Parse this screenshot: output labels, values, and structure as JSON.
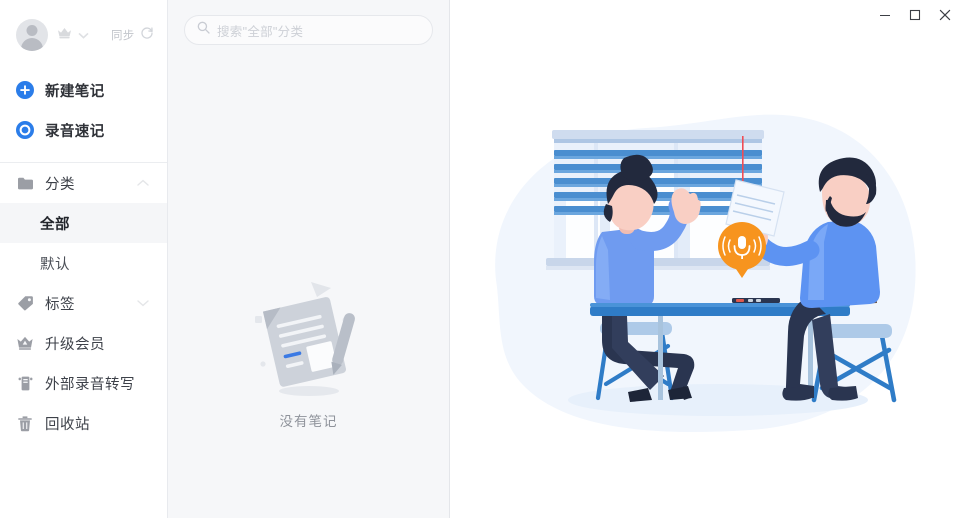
{
  "window": {
    "controls": [
      {
        "name": "minimize",
        "glyph": "minimize-icon",
        "label": "Minimize"
      },
      {
        "name": "maximize",
        "glyph": "maximize-icon",
        "label": "Maximize"
      },
      {
        "name": "close",
        "glyph": "close-icon",
        "label": "Close"
      }
    ]
  },
  "sidebar": {
    "account": {
      "avatar_icon": "user-avatar-icon",
      "vip_icon": "crown-icon",
      "dropdown_icon": "chevron-down-icon",
      "sync_label": "同步",
      "sync_icon": "refresh-icon"
    },
    "actions": [
      {
        "label": "新建笔记",
        "icon": "plus-circle-icon",
        "color": "#2b7de9"
      },
      {
        "label": "录音速记",
        "icon": "record-circle-icon",
        "color": "#2b7de9"
      }
    ],
    "groups": [
      {
        "label": "分类",
        "icon": "folder-icon",
        "chevron": "chevron-up-icon",
        "expanded": true,
        "items": [
          {
            "label": "全部",
            "active": true
          },
          {
            "label": "默认",
            "active": false
          }
        ]
      },
      {
        "label": "标签",
        "icon": "tag-icon",
        "chevron": "chevron-down-icon",
        "expanded": false,
        "items": []
      }
    ],
    "links": [
      {
        "label": "升级会员",
        "icon": "crown-badge-icon"
      },
      {
        "label": "外部录音转写",
        "icon": "recorder-icon"
      },
      {
        "label": "回收站",
        "icon": "trash-icon"
      }
    ]
  },
  "list_panel": {
    "search": {
      "placeholder": "搜索\"全部\"分类",
      "value": "",
      "icon": "search-icon"
    },
    "empty_state": {
      "text": "没有笔记",
      "illustration": "empty-note-document-icon"
    }
  },
  "main_panel": {
    "illustration": {
      "name": "interview-recording-illustration",
      "description": "两人隔桌对谈，桌上放录音笔，窗边百叶窗，悬挂麦克风图标",
      "badge_icon": "microphone-icon",
      "badge_color": "#f7941e",
      "blob_color": "#f2f6fd"
    }
  },
  "colors": {
    "accent": "#2b7de9",
    "sidebar_bg": "#ffffff",
    "list_bg": "#f6f7f9",
    "main_bg": "#ffffff",
    "active_row": "#f5f6f8",
    "text_primary": "#2f3238",
    "text_secondary": "#8f939b",
    "placeholder": "#cdd0d6"
  }
}
